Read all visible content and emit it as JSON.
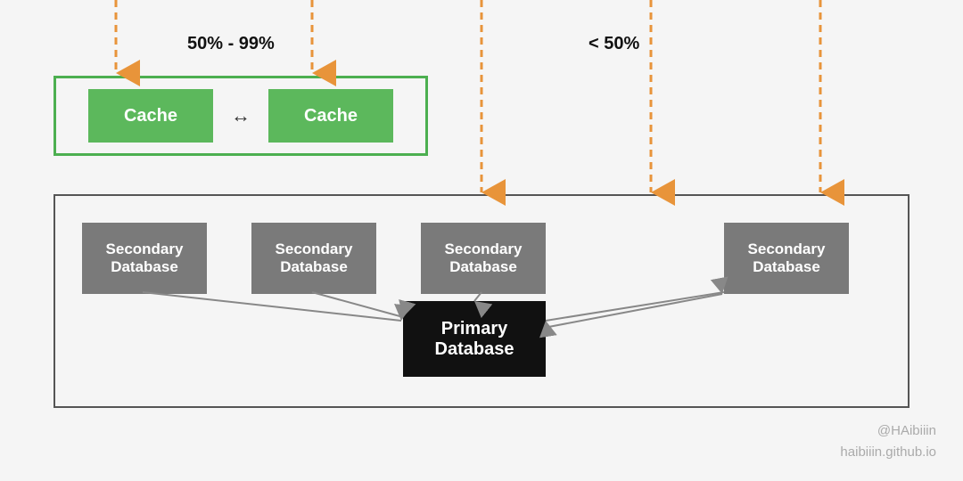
{
  "diagram": {
    "label_50_99": "50% - 99%",
    "label_lt50": "< 50%",
    "cache_label": "Cache",
    "secondary_db_label": "Secondary\nDatabase",
    "primary_db_label": "Primary\nDatabase",
    "watermark_line1": "@HAibiiin",
    "watermark_line2": "haibiiin.github.io"
  }
}
